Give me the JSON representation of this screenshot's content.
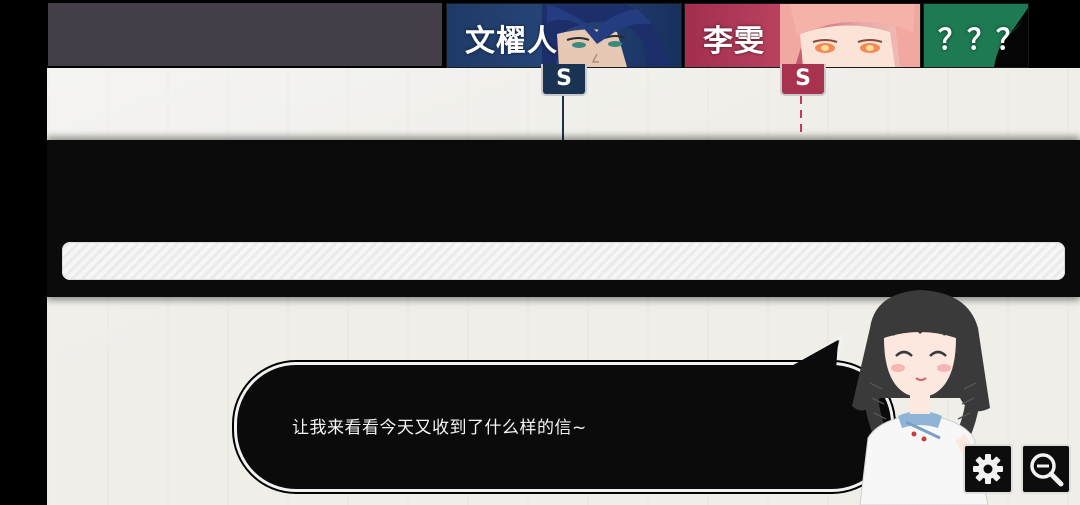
{
  "characters": [
    {
      "name": "文櫂人",
      "marker": "S",
      "color": "#1b3352"
    },
    {
      "name": "李雯",
      "marker": "S",
      "color": "#a7334f"
    },
    {
      "name": "？？？",
      "color": "#1d7a52"
    }
  ],
  "dialogue": {
    "text": "让我来看看今天又收到了什么样的信~"
  },
  "controls": {
    "settings_icon": "gear-icon",
    "zoom_icon": "zoom-out-icon"
  }
}
